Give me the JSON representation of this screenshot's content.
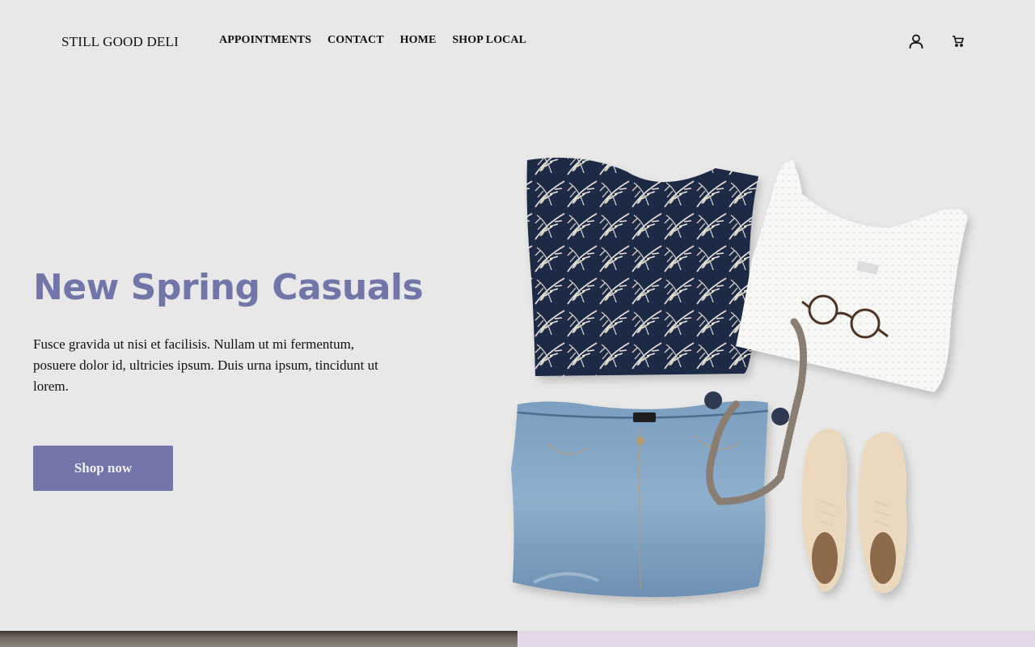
{
  "header": {
    "brand": "STILL GOOD DELI",
    "nav": [
      {
        "label": "APPOINTMENTS"
      },
      {
        "label": "CONTACT"
      },
      {
        "label": "HOME"
      },
      {
        "label": "SHOP LOCAL"
      }
    ],
    "icons": [
      "account-icon",
      "cart-icon"
    ]
  },
  "hero": {
    "title": "New Spring Casuals",
    "text": "Fusce gravida ut nisi et facilisis. Nullam ut mi fermentum, posuere dolor id, ultricies ipsum. Duis urna ipsum, tincidunt ut lorem.",
    "button_label": "Shop now",
    "image_subject": "flat-lay outfit: palm print top, white knit tank, glasses, beaded necklace, denim shorts, cream brogues"
  },
  "colors": {
    "accent": "#7275a8",
    "background": "#e8e8e8",
    "bottom_right_panel": "#e2d8e8"
  }
}
